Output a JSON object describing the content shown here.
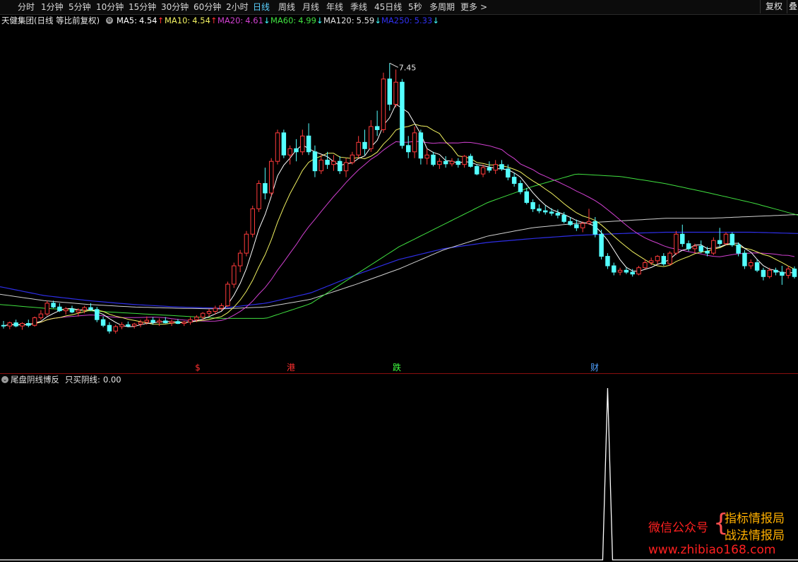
{
  "toolbar": {
    "periods": [
      "分时",
      "1分钟",
      "5分钟",
      "10分钟",
      "15分钟",
      "30分钟",
      "60分钟",
      "2小时",
      "日线",
      "周线",
      "月线",
      "年线",
      "季线",
      "45日线",
      "5秒",
      "多周期",
      "更多"
    ],
    "active_period": "日线",
    "more_arrow": ">",
    "fq_label": "复权",
    "overlay_label": "叠"
  },
  "stock": {
    "title": "天健集团(日线 等比前复权)"
  },
  "ma": [
    {
      "label": "MA5:",
      "value": "4.54",
      "arrow": "↑",
      "color": "#ffffff",
      "arrow_color": "#ff3030"
    },
    {
      "label": "MA10:",
      "value": "4.54",
      "arrow": "↑",
      "color": "#f0f060",
      "arrow_color": "#ff3030"
    },
    {
      "label": "MA20:",
      "value": "4.61",
      "arrow": "↓",
      "color": "#d040d0",
      "arrow_color": "#40ffff"
    },
    {
      "label": "MA60:",
      "value": "4.99",
      "arrow": "↓",
      "color": "#40e040",
      "arrow_color": "#40ffff"
    },
    {
      "label": "MA120:",
      "value": "5.59",
      "arrow": "↓",
      "color": "#e0e0e0",
      "arrow_color": "#40ffff"
    },
    {
      "label": "MA250:",
      "value": "5.33",
      "arrow": "↓",
      "color": "#3030f0",
      "arrow_color": "#40ffff"
    }
  ],
  "colors": {
    "up": "#ff3b3b",
    "down": "#54ffff",
    "ma5": "#ffffff",
    "ma10": "#f0f060",
    "ma20": "#d040d0",
    "ma60": "#40e040",
    "ma120": "#d0d0d0",
    "ma250": "#2e2ee6"
  },
  "high_label": "7.45",
  "events": [
    {
      "text": "$",
      "color": "#ff3030"
    },
    {
      "text": "港",
      "color": "#ff3030"
    },
    {
      "text": "跌",
      "color": "#40ff40"
    },
    {
      "text": "财",
      "color": "#4fa0ff"
    }
  ],
  "indicator": {
    "name": "尾盘阴线博反",
    "output_label": "只买阴线:",
    "output_value": "0.00"
  },
  "watermark": {
    "left": "微信公众号",
    "brace": "{",
    "line1": "指标情报局",
    "line2": "战法情报局",
    "url": "www.zhibiao168.com"
  },
  "chart_data": {
    "type": "candlestick",
    "ylim": [
      3.0,
      7.8
    ],
    "ohlc": [
      [
        3.31,
        3.38,
        3.26,
        3.3
      ],
      [
        3.3,
        3.37,
        3.25,
        3.35
      ],
      [
        3.35,
        3.4,
        3.28,
        3.3
      ],
      [
        3.3,
        3.36,
        3.24,
        3.34
      ],
      [
        3.34,
        3.4,
        3.28,
        3.31
      ],
      [
        3.31,
        3.45,
        3.29,
        3.43
      ],
      [
        3.43,
        3.55,
        3.4,
        3.49
      ],
      [
        3.49,
        3.7,
        3.46,
        3.66
      ],
      [
        3.66,
        3.7,
        3.58,
        3.6
      ],
      [
        3.6,
        3.66,
        3.52,
        3.54
      ],
      [
        3.54,
        3.6,
        3.48,
        3.57
      ],
      [
        3.57,
        3.62,
        3.5,
        3.52
      ],
      [
        3.52,
        3.58,
        3.45,
        3.55
      ],
      [
        3.55,
        3.62,
        3.5,
        3.59
      ],
      [
        3.59,
        3.66,
        3.54,
        3.56
      ],
      [
        3.56,
        3.6,
        3.36,
        3.4
      ],
      [
        3.4,
        3.45,
        3.28,
        3.31
      ],
      [
        3.31,
        3.36,
        3.18,
        3.22
      ],
      [
        3.22,
        3.32,
        3.18,
        3.29
      ],
      [
        3.29,
        3.36,
        3.25,
        3.32
      ],
      [
        3.32,
        3.37,
        3.28,
        3.3
      ],
      [
        3.3,
        3.35,
        3.26,
        3.33
      ],
      [
        3.33,
        3.4,
        3.28,
        3.36
      ],
      [
        3.36,
        3.45,
        3.32,
        3.39
      ],
      [
        3.39,
        3.44,
        3.32,
        3.36
      ],
      [
        3.36,
        3.42,
        3.3,
        3.38
      ],
      [
        3.38,
        3.44,
        3.34,
        3.35
      ],
      [
        3.35,
        3.4,
        3.3,
        3.37
      ],
      [
        3.37,
        3.41,
        3.33,
        3.34
      ],
      [
        3.34,
        3.38,
        3.3,
        3.36
      ],
      [
        3.36,
        3.44,
        3.32,
        3.4
      ],
      [
        3.4,
        3.47,
        3.36,
        3.44
      ],
      [
        3.44,
        3.52,
        3.4,
        3.5
      ],
      [
        3.5,
        3.57,
        3.45,
        3.53
      ],
      [
        3.53,
        3.62,
        3.48,
        3.58
      ],
      [
        3.58,
        3.66,
        3.54,
        3.62
      ],
      [
        3.62,
        4.0,
        3.6,
        3.96
      ],
      [
        3.96,
        4.3,
        3.9,
        4.25
      ],
      [
        4.25,
        4.5,
        4.15,
        4.45
      ],
      [
        4.45,
        4.8,
        4.4,
        4.75
      ],
      [
        4.75,
        5.2,
        4.7,
        5.15
      ],
      [
        5.15,
        5.6,
        5.1,
        5.55
      ],
      [
        5.55,
        5.8,
        5.3,
        5.4
      ],
      [
        5.4,
        5.95,
        5.35,
        5.9
      ],
      [
        5.9,
        6.4,
        5.85,
        6.35
      ],
      [
        6.35,
        6.4,
        5.95,
        6.0
      ],
      [
        6.0,
        6.15,
        5.85,
        6.1
      ],
      [
        6.1,
        6.25,
        5.9,
        6.05
      ],
      [
        6.05,
        6.4,
        6.0,
        6.3
      ],
      [
        6.3,
        6.5,
        6.0,
        6.05
      ],
      [
        6.05,
        6.15,
        5.65,
        5.75
      ],
      [
        5.75,
        6.0,
        5.7,
        5.92
      ],
      [
        5.92,
        6.05,
        5.78,
        5.85
      ],
      [
        5.85,
        6.0,
        5.75,
        5.9
      ],
      [
        5.9,
        5.98,
        5.7,
        5.75
      ],
      [
        5.75,
        5.95,
        5.65,
        5.88
      ],
      [
        5.88,
        6.05,
        5.85,
        6.0
      ],
      [
        6.0,
        6.3,
        5.95,
        6.2
      ],
      [
        6.2,
        6.4,
        6.0,
        6.1
      ],
      [
        6.1,
        6.55,
        6.05,
        6.45
      ],
      [
        6.45,
        6.7,
        6.3,
        6.4
      ],
      [
        6.4,
        7.3,
        6.35,
        7.2
      ],
      [
        7.2,
        7.45,
        6.7,
        6.8
      ],
      [
        6.8,
        7.35,
        6.75,
        7.15
      ],
      [
        7.15,
        7.2,
        6.1,
        6.15
      ],
      [
        6.15,
        6.3,
        5.95,
        6.05
      ],
      [
        6.05,
        6.45,
        5.95,
        6.35
      ],
      [
        6.35,
        6.4,
        5.85,
        5.95
      ],
      [
        5.95,
        6.1,
        5.85,
        6.0
      ],
      [
        6.0,
        6.05,
        5.82,
        5.85
      ],
      [
        5.85,
        5.95,
        5.78,
        5.9
      ],
      [
        5.9,
        5.98,
        5.8,
        5.86
      ],
      [
        5.86,
        5.95,
        5.82,
        5.9
      ],
      [
        5.9,
        5.95,
        5.8,
        5.85
      ],
      [
        5.85,
        6.0,
        5.8,
        5.98
      ],
      [
        5.98,
        6.02,
        5.8,
        5.82
      ],
      [
        5.82,
        5.85,
        5.68,
        5.7
      ],
      [
        5.7,
        5.85,
        5.65,
        5.8
      ],
      [
        5.8,
        5.9,
        5.72,
        5.76
      ],
      [
        5.76,
        5.92,
        5.7,
        5.85
      ],
      [
        5.85,
        5.92,
        5.75,
        5.78
      ],
      [
        5.78,
        5.85,
        5.6,
        5.65
      ],
      [
        5.65,
        5.72,
        5.5,
        5.55
      ],
      [
        5.55,
        5.6,
        5.38,
        5.42
      ],
      [
        5.42,
        5.48,
        5.22,
        5.25
      ],
      [
        5.25,
        5.3,
        5.1,
        5.15
      ],
      [
        5.15,
        5.22,
        5.08,
        5.12
      ],
      [
        5.12,
        5.2,
        5.06,
        5.1
      ],
      [
        5.1,
        5.16,
        5.04,
        5.08
      ],
      [
        5.08,
        5.14,
        5.0,
        5.05
      ],
      [
        5.05,
        5.1,
        4.92,
        4.95
      ],
      [
        4.95,
        5.02,
        4.88,
        4.9
      ],
      [
        4.9,
        4.98,
        4.8,
        4.85
      ],
      [
        4.85,
        4.95,
        4.78,
        4.92
      ],
      [
        4.92,
        5.15,
        4.9,
        4.95
      ],
      [
        4.95,
        5.02,
        4.7,
        4.75
      ],
      [
        4.75,
        4.82,
        4.35,
        4.4
      ],
      [
        4.4,
        4.45,
        4.2,
        4.25
      ],
      [
        4.25,
        4.3,
        4.1,
        4.15
      ],
      [
        4.15,
        4.22,
        4.1,
        4.18
      ],
      [
        4.18,
        4.22,
        4.12,
        4.15
      ],
      [
        4.15,
        4.2,
        4.08,
        4.12
      ],
      [
        4.12,
        4.25,
        4.1,
        4.22
      ],
      [
        4.22,
        4.35,
        4.2,
        4.3
      ],
      [
        4.3,
        4.38,
        4.26,
        4.33
      ],
      [
        4.33,
        4.42,
        4.28,
        4.4
      ],
      [
        4.4,
        4.45,
        4.25,
        4.28
      ],
      [
        4.28,
        4.48,
        4.25,
        4.45
      ],
      [
        4.45,
        4.8,
        4.42,
        4.75
      ],
      [
        4.75,
        4.9,
        4.55,
        4.6
      ],
      [
        4.6,
        4.65,
        4.48,
        4.52
      ],
      [
        4.52,
        4.6,
        4.45,
        4.56
      ],
      [
        4.56,
        4.65,
        4.45,
        4.48
      ],
      [
        4.48,
        4.55,
        4.4,
        4.45
      ],
      [
        4.45,
        4.7,
        4.42,
        4.65
      ],
      [
        4.65,
        4.85,
        4.55,
        4.6
      ],
      [
        4.6,
        4.78,
        4.58,
        4.75
      ],
      [
        4.75,
        4.78,
        4.55,
        4.58
      ],
      [
        4.58,
        4.62,
        4.4,
        4.45
      ],
      [
        4.45,
        4.5,
        4.2,
        4.25
      ],
      [
        4.25,
        4.35,
        4.2,
        4.3
      ],
      [
        4.3,
        4.35,
        4.15,
        4.18
      ],
      [
        4.18,
        4.22,
        4.02,
        4.08
      ],
      [
        4.08,
        4.22,
        4.05,
        4.18
      ],
      [
        4.18,
        4.22,
        4.1,
        4.15
      ],
      [
        4.15,
        4.25,
        3.95,
        4.1
      ],
      [
        4.1,
        4.25,
        4.05,
        4.2
      ],
      [
        4.2,
        4.24,
        4.05,
        4.08
      ]
    ],
    "ma250": [
      3.92,
      3.78,
      3.7,
      3.64,
      3.6,
      3.58,
      3.66,
      3.82,
      4.1,
      4.35,
      4.52,
      4.62,
      4.68,
      4.73,
      4.76,
      4.78,
      4.78,
      4.78,
      4.76
    ],
    "ma120": [
      3.8,
      3.7,
      3.64,
      3.6,
      3.58,
      3.57,
      3.6,
      3.72,
      3.95,
      4.2,
      4.5,
      4.72,
      4.85,
      4.92,
      4.96,
      5.0,
      5.0,
      5.03,
      5.06
    ],
    "ma60": [
      3.64,
      3.58,
      3.54,
      3.5,
      3.46,
      3.42,
      3.42,
      3.65,
      4.1,
      4.55,
      4.9,
      5.25,
      5.5,
      5.7,
      5.66,
      5.55,
      5.4,
      5.24,
      5.05
    ],
    "indicator_signal": {
      "bar_index": 97,
      "value": 1.0
    }
  }
}
